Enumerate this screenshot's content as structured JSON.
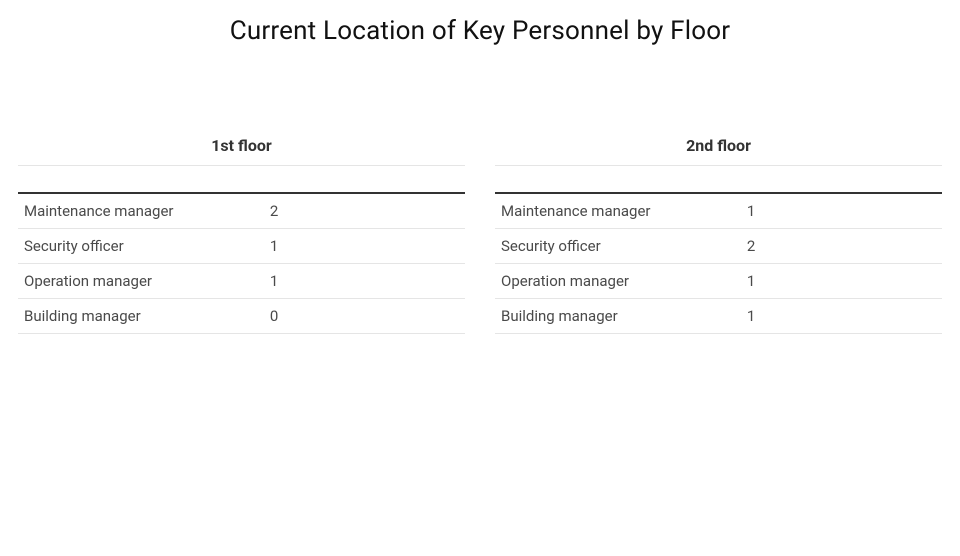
{
  "title": "Current Location of Key Personnel by Floor",
  "tables": [
    {
      "header": "1st floor",
      "rows": [
        {
          "role": "Maintenance manager",
          "count": "2"
        },
        {
          "role": "Security officer",
          "count": "1"
        },
        {
          "role": "Operation manager",
          "count": "1"
        },
        {
          "role": "Building manager",
          "count": "0"
        }
      ]
    },
    {
      "header": "2nd floor",
      "rows": [
        {
          "role": "Maintenance manager",
          "count": "1"
        },
        {
          "role": "Security officer",
          "count": "2"
        },
        {
          "role": "Operation manager",
          "count": "1"
        },
        {
          "role": "Building manager",
          "count": "1"
        }
      ]
    }
  ],
  "chart_data": {
    "type": "table",
    "title": "Current Location of Key Personnel by Floor",
    "series": [
      {
        "name": "1st floor",
        "categories": [
          "Maintenance manager",
          "Security officer",
          "Operation manager",
          "Building manager"
        ],
        "values": [
          2,
          1,
          1,
          0
        ]
      },
      {
        "name": "2nd floor",
        "categories": [
          "Maintenance manager",
          "Security officer",
          "Operation manager",
          "Building manager"
        ],
        "values": [
          1,
          2,
          1,
          1
        ]
      }
    ]
  }
}
